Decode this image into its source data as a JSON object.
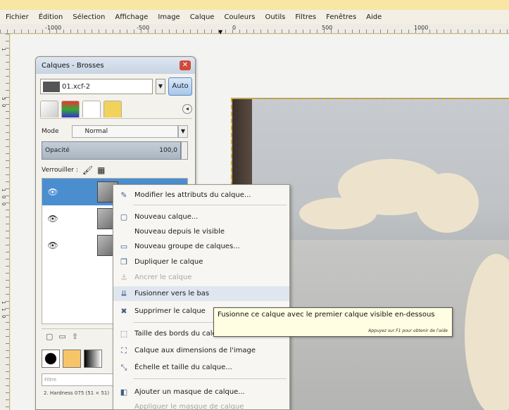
{
  "menubar": {
    "items": [
      "Fichier",
      "Édition",
      "Sélection",
      "Affichage",
      "Image",
      "Calque",
      "Couleurs",
      "Outils",
      "Filtres",
      "Fenêtres",
      "Aide"
    ]
  },
  "ruler": {
    "labels": [
      "-1000",
      "-500",
      "0",
      "500",
      "1000"
    ],
    "vlabels": [
      "1",
      "5",
      "0",
      "1",
      "0",
      "0",
      "1",
      "1",
      "0"
    ]
  },
  "dock": {
    "title": "Calques - Brosses",
    "close_glyph": "✕",
    "image_name": "01.xcf-2",
    "auto_label": "Auto",
    "mode_label": "Mode",
    "mode_value": "Normal",
    "opacity_label": "Opacité",
    "opacity_value": "100,0",
    "lock_label": "Verrouiller :",
    "brush_filter_placeholder": "Filtre",
    "brush_name": "2. Hardness 075 (51 × 51)"
  },
  "context_menu": {
    "items": [
      {
        "label": "Modifier les attributs du calque...",
        "icon": "edit-icon",
        "glyph": "✎",
        "disabled": false
      },
      {
        "label": "Nouveau calque...",
        "icon": "new-layer-icon",
        "glyph": "▢",
        "disabled": false
      },
      {
        "label": "Nouveau depuis le visible",
        "icon": "",
        "glyph": "",
        "disabled": false
      },
      {
        "label": "Nouveau groupe de calques...",
        "icon": "folder-icon",
        "glyph": "▭",
        "disabled": false
      },
      {
        "label": "Dupliquer le calque",
        "icon": "duplicate-icon",
        "glyph": "❐",
        "disabled": false
      },
      {
        "label": "Ancrer le calque",
        "icon": "anchor-icon",
        "glyph": "⚓",
        "disabled": true
      },
      {
        "label": "Fusionner vers le bas",
        "icon": "merge-down-icon",
        "glyph": "⇊",
        "disabled": false
      },
      {
        "label": "Supprimer le calque",
        "icon": "delete-icon",
        "glyph": "✖",
        "disabled": false
      },
      {
        "label": "Taille des bords du calque...",
        "icon": "border-size-icon",
        "glyph": "⬚",
        "disabled": false
      },
      {
        "label": "Calque aux dimensions de l'image",
        "icon": "fit-image-icon",
        "glyph": "⛶",
        "disabled": false
      },
      {
        "label": "Échelle et taille du calque...",
        "icon": "scale-icon",
        "glyph": "⤡",
        "disabled": false
      },
      {
        "label": "Ajouter un masque de calque...",
        "icon": "mask-icon",
        "glyph": "◧",
        "disabled": false
      },
      {
        "label": "Appliquer le masque de calque",
        "icon": "",
        "glyph": "",
        "disabled": true
      }
    ]
  },
  "tooltip": {
    "text": "Fusionne ce calque avec le premier calque visible en-dessous",
    "hint": "Appuyez sur F1 pour obtenir de l'aide"
  }
}
